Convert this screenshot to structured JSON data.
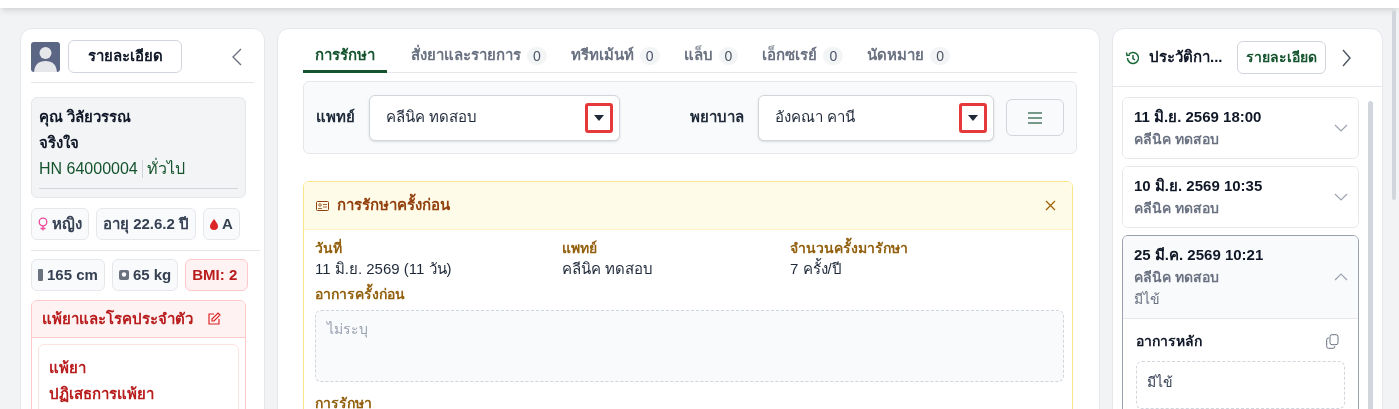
{
  "patient_panel": {
    "details_button": "รายละเอียด",
    "name_lines": [
      "คุณ วิลัยวรรณ",
      "จริงใจ"
    ],
    "hn": "HN 64000004",
    "patient_type": "ทั่วไป",
    "chips_row1": [
      {
        "kind": "gender",
        "text": "หญิง"
      },
      {
        "kind": "plain",
        "text": "อายุ 22.6.2 ปี"
      },
      {
        "kind": "blood",
        "text": "A"
      }
    ],
    "chips_row2": [
      {
        "kind": "height",
        "text": "165 cm"
      },
      {
        "kind": "weight",
        "text": "65 kg"
      },
      {
        "kind": "alert",
        "text": "BMI: 2"
      }
    ],
    "allergy_section": {
      "title": "แพ้ยาและโรคประจำตัว",
      "items": [
        {
          "label": "แพ้ยา",
          "value": "ปฏิเสธการแพ้ยา"
        }
      ]
    }
  },
  "tabs": [
    {
      "label": "การรักษา",
      "selected": true
    },
    {
      "label": "สั่งยาและรายการ",
      "count": "0",
      "selected": false
    },
    {
      "label": "ทรีทเม้นท์",
      "count": "0",
      "selected": false
    },
    {
      "label": "แล็บ",
      "count": "0",
      "selected": false
    },
    {
      "label": "เอ็กซเรย์",
      "count": "0",
      "selected": false
    },
    {
      "label": "นัดหมาย",
      "count": "0",
      "selected": false
    }
  ],
  "selects": [
    {
      "label": "แพทย์",
      "value": "คลีนิค ทดสอบ",
      "highlighted": true
    },
    {
      "label": "พยาบาล",
      "value": "อังคณา คานี",
      "highlighted": true
    }
  ],
  "previous_treatment": {
    "title": "การรักษาครั้งก่อน",
    "fields": [
      {
        "label": "วันที่",
        "value": "11 มิ.ย. 2569 (11 วัน)"
      },
      {
        "label": "แพทย์",
        "value": "คลีนิค ทดสอบ"
      },
      {
        "label": "จำนวนครั้งมารักษา",
        "value": "7 ครั้ง/ปี"
      }
    ],
    "symptoms_label": "อาการครั้งก่อน",
    "symptoms_placeholder": "ไม่ระบุ",
    "treatment_label": "การรักษา"
  },
  "history_panel": {
    "title": "ประวัติกา...",
    "details_button": "รายละเอียด",
    "visits": [
      {
        "datetime": "11 มิ.ย. 2569 18:00",
        "clinic": "คลีนิค ทดสอบ",
        "expanded": false
      },
      {
        "datetime": "10 มิ.ย. 2569 10:35",
        "clinic": "คลีนิค ทดสอบ",
        "expanded": false
      },
      {
        "datetime": "25 มี.ค. 2569 10:21",
        "clinic": "คลีนิค ทดสอบ",
        "note": "มีไข้",
        "expanded": true,
        "chief_complaint_label": "อาการหลัก",
        "chief_complaint": "มีไข้"
      }
    ]
  }
}
